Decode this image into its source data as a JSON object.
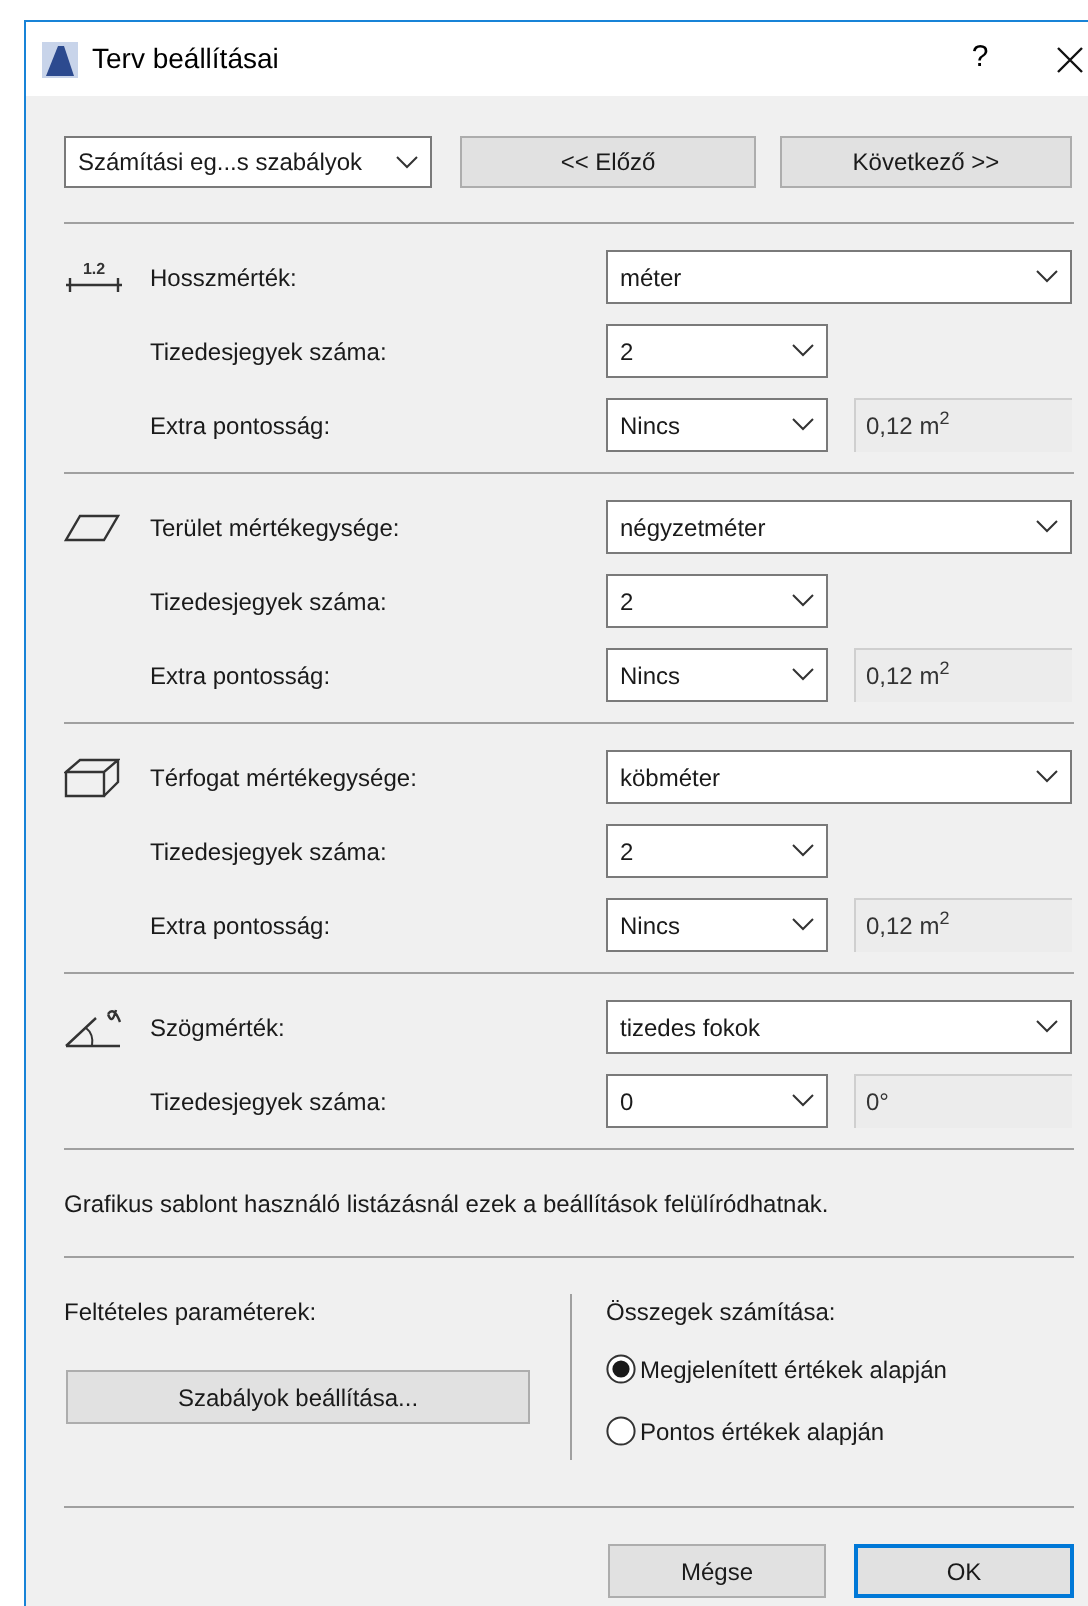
{
  "window": {
    "title": "Terv beállításai",
    "help": "?"
  },
  "nav": {
    "dropdown": "Számítási eg...s szabályok",
    "buttons": [
      "<< Előző",
      "Következő >>"
    ]
  },
  "sections": [
    {
      "kind": "length",
      "icon_label": "1.2",
      "rows": [
        {
          "label": "Hosszmérték:",
          "value": "méter",
          "kind": "main"
        },
        {
          "label": "Tizedesjegyek száma:",
          "value": "2",
          "kind": "sub"
        },
        {
          "label": "Extra pontosság:",
          "value": "Nincs",
          "kind": "sub",
          "readout": "0,12 m$^{2}$"
        }
      ]
    },
    {
      "kind": "area",
      "rows": [
        {
          "label": "Terület mértékegysége:",
          "value": "négyzetméter",
          "kind": "main"
        },
        {
          "label": "Tizedesjegyek száma:",
          "value": "2",
          "kind": "sub"
        },
        {
          "label": "Extra pontosság:",
          "value": "Nincs",
          "kind": "sub",
          "readout": "0,12 m$^{2}$"
        }
      ]
    },
    {
      "kind": "volume",
      "rows": [
        {
          "label": "Térfogat mértékegysége:",
          "value": "köbméter",
          "kind": "main"
        },
        {
          "label": "Tizedesjegyek száma:",
          "value": "2",
          "kind": "sub"
        },
        {
          "label": "Extra pontosság:",
          "value": "Nincs",
          "kind": "sub",
          "readout": "0,12 m$^{2}$"
        }
      ]
    },
    {
      "kind": "angle",
      "rows": [
        {
          "label": "Szögmérték:",
          "value": "tizedes fokok",
          "kind": "main"
        },
        {
          "label": "Tizedesjegyek száma:",
          "value": "0",
          "kind": "sub",
          "readout": "0°"
        }
      ]
    }
  ],
  "note": "Grafikus sablont használó listázásnál ezek a beállítások felülíródhatnak.",
  "conditional": {
    "label": "Feltételes paraméterek:",
    "button": "Szabályok beállítása..."
  },
  "totals": {
    "label": "Összegek számítása:",
    "options": [
      {
        "label": "Megjelenített értékek alapján",
        "selected": true
      },
      {
        "label": "Pontos értékek alapján",
        "selected": false
      }
    ]
  },
  "footer": [
    {
      "label": "Mégse",
      "default": false
    },
    {
      "label": "OK",
      "default": true
    }
  ]
}
